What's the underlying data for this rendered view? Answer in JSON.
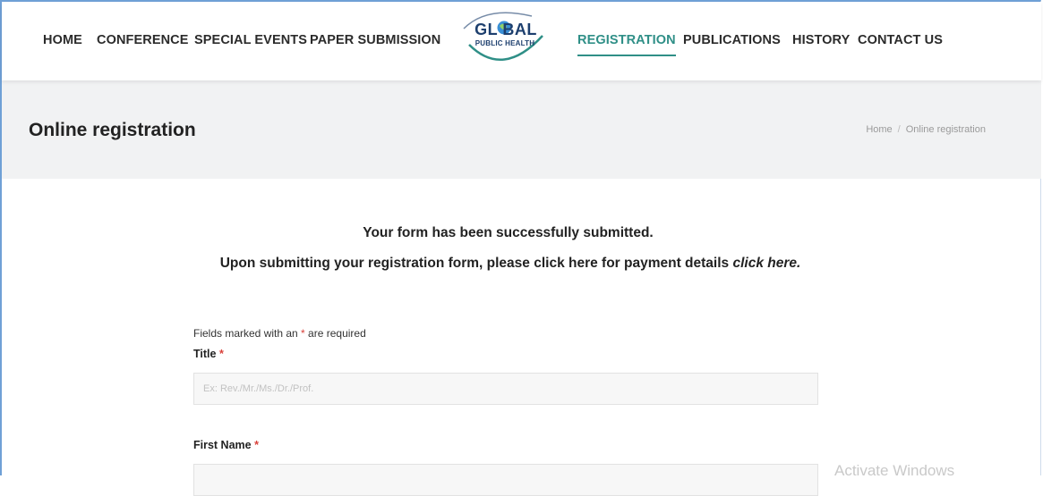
{
  "nav": {
    "items": [
      {
        "label": "HOME"
      },
      {
        "label": "CONFERENCE"
      },
      {
        "label": "SPECIAL EVENTS"
      },
      {
        "label": "PAPER SUBMISSION"
      },
      {
        "label": "REGISTRATION",
        "active": true
      },
      {
        "label": "PUBLICATIONS"
      },
      {
        "label": "HISTORY"
      },
      {
        "label": "CONTACT US"
      }
    ],
    "logo_title": "GL BAL",
    "logo_subtitle": "PUBLIC HEALTH"
  },
  "page": {
    "title": "Online registration",
    "breadcrumb": [
      "Home",
      "Online registration"
    ],
    "breadcrumb_separator": "/"
  },
  "messages": {
    "success": "Your form has been successfully submitted.",
    "payment_prefix": "Upon submitting your registration form, please click here for payment details ",
    "payment_link": "click here."
  },
  "form": {
    "required_note_prefix": "Fields marked with an ",
    "required_star": "*",
    "required_note_suffix": " are required",
    "fields": [
      {
        "label": "Title",
        "placeholder": "Ex: Rev./Mr./Ms./Dr./Prof.",
        "value": ""
      },
      {
        "label": "First Name",
        "placeholder": "",
        "value": ""
      }
    ]
  },
  "system": {
    "watermark": "Activate Windows"
  },
  "colors": {
    "accent": "#2f8f87",
    "required": "#d9403a",
    "logo_blue": "#1d3f6e"
  }
}
